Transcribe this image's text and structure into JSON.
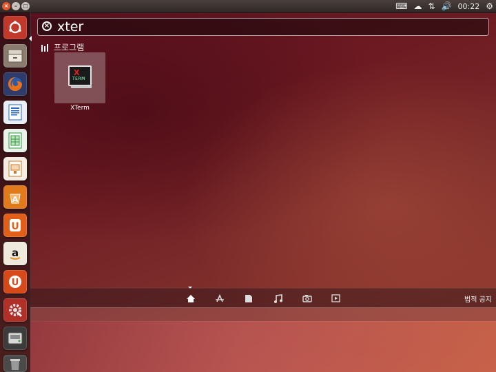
{
  "top_panel": {
    "time": "00:22",
    "icons": [
      "close-icon",
      "minimize-icon",
      "maximize-icon",
      "keyboard-icon",
      "cloud-icon",
      "network-icon",
      "volume-icon",
      "gear-icon"
    ]
  },
  "launcher": {
    "items": [
      {
        "name": "ubuntu-dash",
        "icon": "ubuntu-logo-icon",
        "color": "#c0392b"
      },
      {
        "name": "files",
        "icon": "file-cabinet-icon",
        "color": "#8a7d6f"
      },
      {
        "name": "firefox",
        "icon": "firefox-icon",
        "color": "#e36a1a"
      },
      {
        "name": "libreoffice-writer",
        "icon": "writer-icon",
        "color": "#2a6ac0"
      },
      {
        "name": "libreoffice-calc",
        "icon": "calc-icon",
        "color": "#2e9a3a"
      },
      {
        "name": "libreoffice-impress",
        "icon": "impress-icon",
        "color": "#c97a2a"
      },
      {
        "name": "software-center",
        "icon": "software-center-icon",
        "color": "#e07a1a"
      },
      {
        "name": "ubuntu-one",
        "icon": "ubuntu-one-icon",
        "color": "#e0601a"
      },
      {
        "name": "amazon",
        "icon": "amazon-icon",
        "color": "#e8e0d0"
      },
      {
        "name": "ubuntu-one-music",
        "icon": "ubuntu-one-music-icon",
        "color": "#d64a1a"
      },
      {
        "name": "system-settings",
        "icon": "settings-icon",
        "color": "#b03028"
      },
      {
        "name": "drive",
        "icon": "drive-icon",
        "color": "#4a4a4a"
      },
      {
        "name": "trash",
        "icon": "trash-icon",
        "color": "#5a5a5a"
      }
    ]
  },
  "search": {
    "value": "xter"
  },
  "results": {
    "category": "프로그램",
    "items": [
      {
        "label": "XTerm",
        "icon": "xterm-icon"
      }
    ]
  },
  "lens_bar": {
    "lenses": [
      "home-icon",
      "applications-icon",
      "files-icon",
      "music-icon",
      "photos-icon",
      "video-icon"
    ],
    "legal_label": "법적 공지"
  },
  "colors": {
    "accent": "#e4572e",
    "panel": "#3a3230"
  }
}
